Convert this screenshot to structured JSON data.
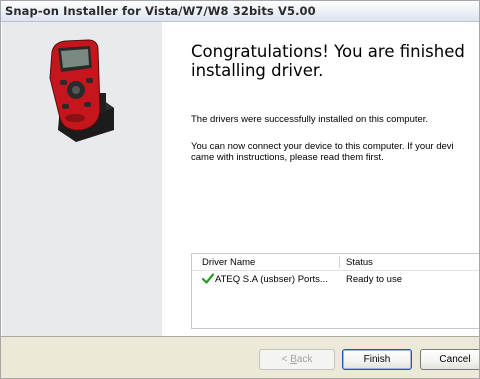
{
  "window": {
    "title": "Snap-on Installer for Vista/W7/W8 32bits V5.00"
  },
  "content": {
    "heading": "Congratulations! You are finished\ninstalling driver.",
    "paragraph1": "The drivers were successfully installed on this computer.",
    "paragraph2_line1": "You can now connect your device to this computer. If your devi",
    "paragraph2_line2": "came with instructions, please read them first."
  },
  "driver_list": {
    "columns": [
      "Driver Name",
      "Status"
    ],
    "rows": [
      {
        "name": "ATEQ S.A (usbser) Ports...",
        "status": "Ready to use",
        "icon": "check-icon"
      }
    ]
  },
  "buttons": {
    "back_label": "< Back",
    "finish_label": "Finish",
    "cancel_label": "Cancel"
  },
  "colors": {
    "check_green": "#2a9a2a",
    "device_red": "#c4161c"
  }
}
